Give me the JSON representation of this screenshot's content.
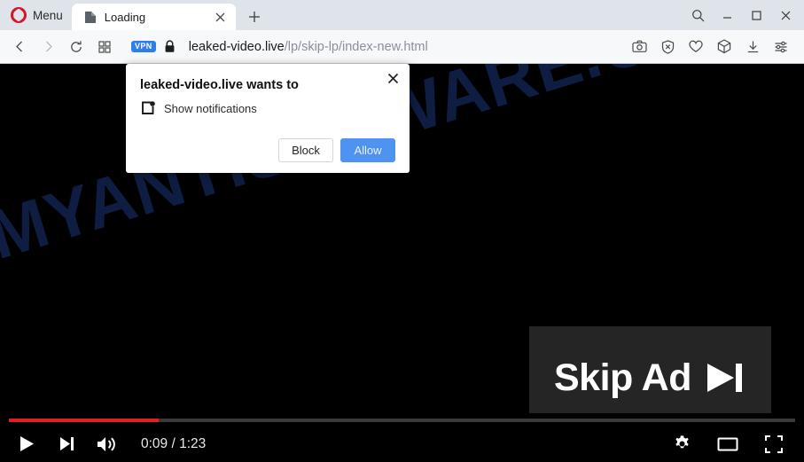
{
  "browser": {
    "menu_label": "Menu",
    "opera_logo_icon": "opera-logo-icon",
    "tab": {
      "title": "Loading",
      "favicon_icon": "page-document-icon",
      "close_icon": "close-icon"
    },
    "new_tab_icon": "plus-icon",
    "window_controls": {
      "search_icon": "search-icon",
      "minimize_icon": "minimize-icon",
      "maximize_icon": "maximize-icon",
      "close_icon": "close-icon"
    },
    "toolbar": {
      "back_icon": "chevron-left-icon",
      "forward_icon": "chevron-right-icon",
      "reload_icon": "reload-icon",
      "apps_icon": "grid-apps-icon",
      "vpn_badge": "VPN",
      "lock_icon": "lock-icon",
      "url_domain": "leaked-video.live",
      "url_path": "/lp/skip-lp/index-new.html",
      "snapshot_icon": "camera-icon",
      "adblock_icon": "shield-block-icon",
      "favorites_icon": "heart-icon",
      "extensions_icon": "cube-icon",
      "downloads_icon": "download-icon",
      "easy_setup_icon": "sliders-settings-icon"
    }
  },
  "dialog": {
    "title": "leaked-video.live wants to",
    "permission_label": "Show notifications",
    "permission_icon": "notification-icon",
    "close_icon": "close-icon",
    "block_label": "Block",
    "allow_label": "Allow",
    "allow_color": "#4f93f0"
  },
  "page": {
    "watermark": "MYANTISPYWARE.COM",
    "watermark_color": "#0f1f45",
    "background_color": "#000000",
    "skip_ad": {
      "label": "Skip Ad",
      "icon": "skip-next-icon",
      "background_color": "#252525"
    }
  },
  "player": {
    "play_icon": "play-icon",
    "next_icon": "skip-next-icon",
    "volume_icon": "volume-icon",
    "time_display": "0:09 / 1:23",
    "current_time": "0:09",
    "duration": "1:23",
    "progress_percent": 19,
    "progress_color": "#e02020",
    "settings_icon": "gear-icon",
    "miniplayer_icon": "miniplayer-icon",
    "fullscreen_icon": "fullscreen-icon"
  }
}
